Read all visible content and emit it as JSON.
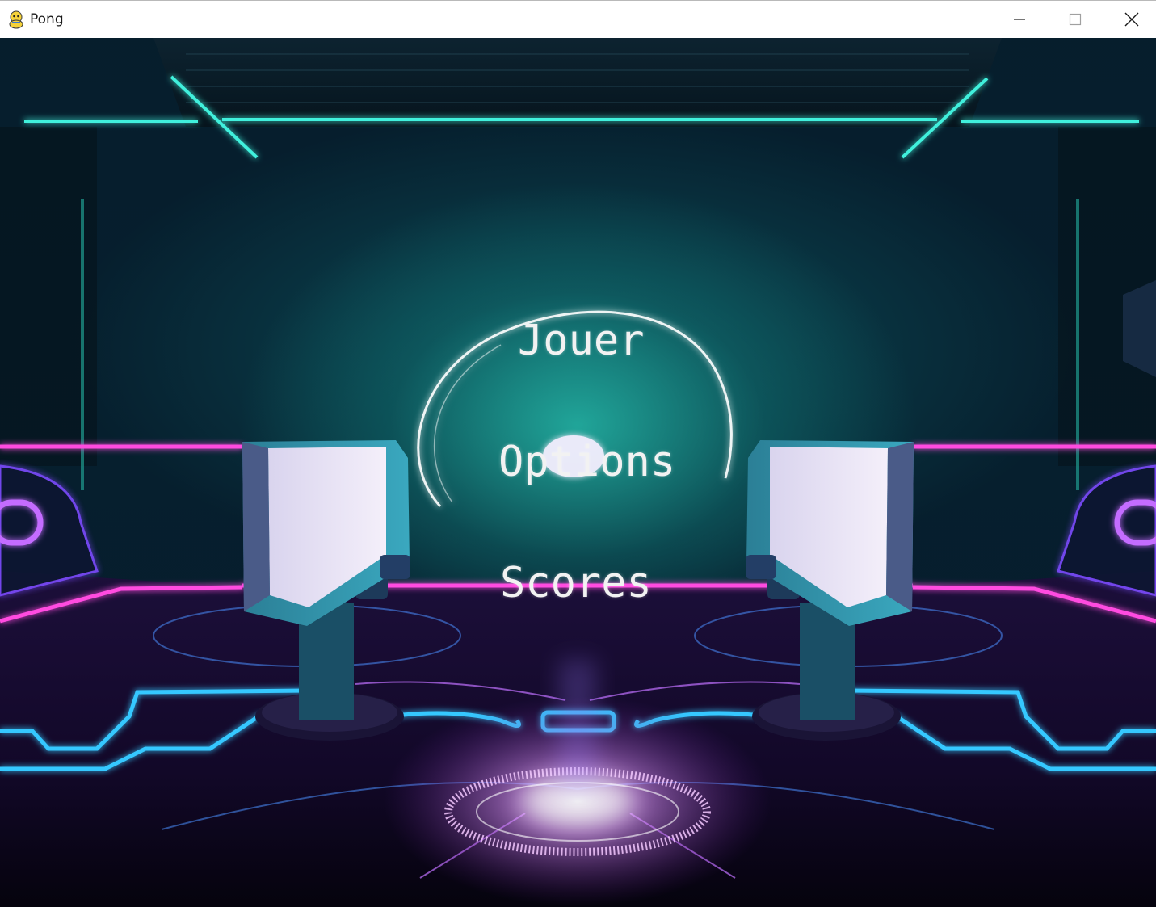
{
  "window": {
    "title": "Pong",
    "icon": "pygame-snake-icon",
    "controls": {
      "minimize_icon": "minimize-icon",
      "maximize_icon": "maximize-icon",
      "close_icon": "close-icon"
    }
  },
  "menu": {
    "items": [
      {
        "label": "Jouer"
      },
      {
        "label": "Options"
      },
      {
        "label": "Scores"
      }
    ]
  },
  "colors": {
    "neon_cyan": "#2ee6d6",
    "neon_magenta": "#e040d0",
    "neon_blue": "#2fb8ff",
    "neon_violet": "#b070ff",
    "menu_text": "#f2f2f2"
  }
}
